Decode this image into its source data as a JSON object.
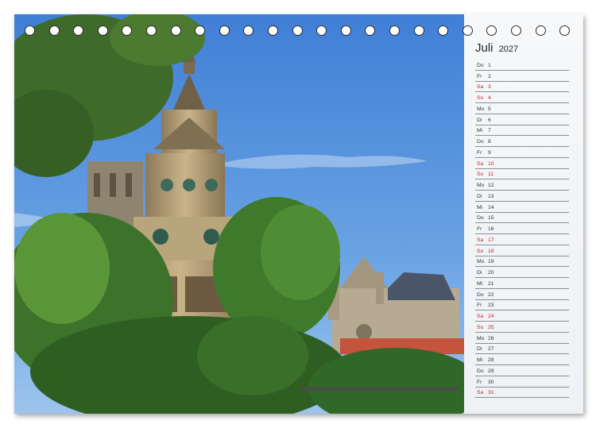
{
  "calendar": {
    "month": "Juli",
    "year": "2027",
    "weekend_color": "#c8262a",
    "days": [
      {
        "wd": "Do",
        "d": "1",
        "we": false
      },
      {
        "wd": "Fr",
        "d": "2",
        "we": false
      },
      {
        "wd": "Sa",
        "d": "3",
        "we": true
      },
      {
        "wd": "So",
        "d": "4",
        "we": true
      },
      {
        "wd": "Mo",
        "d": "5",
        "we": false
      },
      {
        "wd": "Di",
        "d": "6",
        "we": false
      },
      {
        "wd": "Mi",
        "d": "7",
        "we": false
      },
      {
        "wd": "Do",
        "d": "8",
        "we": false
      },
      {
        "wd": "Fr",
        "d": "9",
        "we": false
      },
      {
        "wd": "Sa",
        "d": "10",
        "we": true
      },
      {
        "wd": "So",
        "d": "11",
        "we": true
      },
      {
        "wd": "Mo",
        "d": "12",
        "we": false
      },
      {
        "wd": "Di",
        "d": "13",
        "we": false
      },
      {
        "wd": "Mi",
        "d": "14",
        "we": false
      },
      {
        "wd": "Do",
        "d": "15",
        "we": false
      },
      {
        "wd": "Fr",
        "d": "16",
        "we": false
      },
      {
        "wd": "Sa",
        "d": "17",
        "we": true
      },
      {
        "wd": "So",
        "d": "18",
        "we": true
      },
      {
        "wd": "Mo",
        "d": "19",
        "we": false
      },
      {
        "wd": "Di",
        "d": "20",
        "we": false
      },
      {
        "wd": "Mi",
        "d": "21",
        "we": false
      },
      {
        "wd": "Do",
        "d": "22",
        "we": false
      },
      {
        "wd": "Fr",
        "d": "23",
        "we": false
      },
      {
        "wd": "Sa",
        "d": "24",
        "we": true
      },
      {
        "wd": "So",
        "d": "25",
        "we": true
      },
      {
        "wd": "Mo",
        "d": "26",
        "we": false
      },
      {
        "wd": "Di",
        "d": "27",
        "we": false
      },
      {
        "wd": "Mi",
        "d": "28",
        "we": false
      },
      {
        "wd": "Do",
        "d": "29",
        "we": false
      },
      {
        "wd": "Fr",
        "d": "30",
        "we": false
      },
      {
        "wd": "Sa",
        "d": "31",
        "we": true
      }
    ]
  },
  "binding_hole_count": 23
}
